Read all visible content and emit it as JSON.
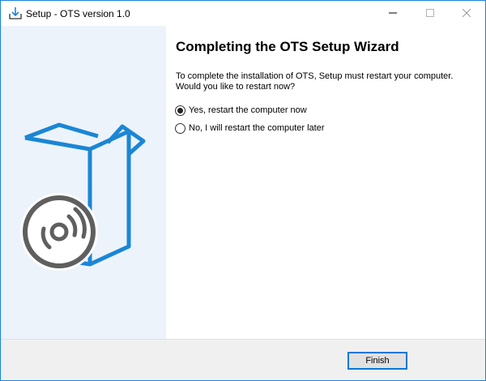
{
  "window": {
    "title": "Setup - OTS version 1.0"
  },
  "caption_buttons": {
    "minimize_icon": "minimize-icon",
    "maximize_icon": "maximize-icon",
    "close_icon": "close-icon"
  },
  "left_panel": {
    "illustration": "box-with-disc-illustration",
    "colors": {
      "box": "#1a86d6",
      "disc": "#5f5f5f",
      "background": "#edf3fa"
    }
  },
  "main": {
    "heading": "Completing the OTS Setup Wizard",
    "description": "To complete the installation of OTS, Setup must restart your computer. Would you like to restart now?",
    "options": [
      {
        "label": "Yes, restart the computer now",
        "selected": true
      },
      {
        "label": "No, I will restart the computer later",
        "selected": false
      }
    ]
  },
  "footer": {
    "finish_label": "Finish"
  },
  "colors": {
    "accent": "#0078d7",
    "footer_bg": "#f0f0f0"
  }
}
